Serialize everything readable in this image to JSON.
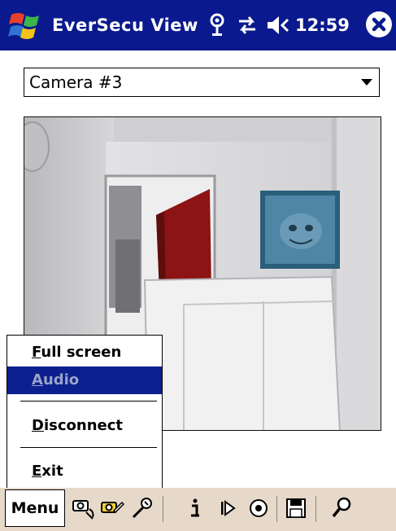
{
  "titlebar": {
    "app_title": "EverSecu View",
    "clock": "12:59",
    "icons": [
      "windows-start-icon",
      "antenna-icon",
      "connectivity-icon",
      "speaker-icon",
      "close-icon"
    ]
  },
  "camera_select": {
    "value": "Camera #3"
  },
  "menu": {
    "items": [
      {
        "accel": "F",
        "rest": "ull screen",
        "selected": false
      },
      {
        "accel": "A",
        "rest": "udio",
        "selected": true
      },
      {
        "accel": "D",
        "rest": "isconnect",
        "selected": false
      },
      {
        "accel": "E",
        "rest": "xit",
        "selected": false
      }
    ]
  },
  "toolbar": {
    "menu_label": "Menu",
    "tools": [
      "camera-connect-icon",
      "camera-settings-icon",
      "tools-icon",
      "info-icon",
      "play-icon",
      "record-icon",
      "save-icon",
      "search-icon"
    ]
  },
  "colors": {
    "titlebar": "#0a1a8e",
    "menu_selected": "#0b1f8f",
    "toolbar_bg": "#e6d9c9"
  }
}
